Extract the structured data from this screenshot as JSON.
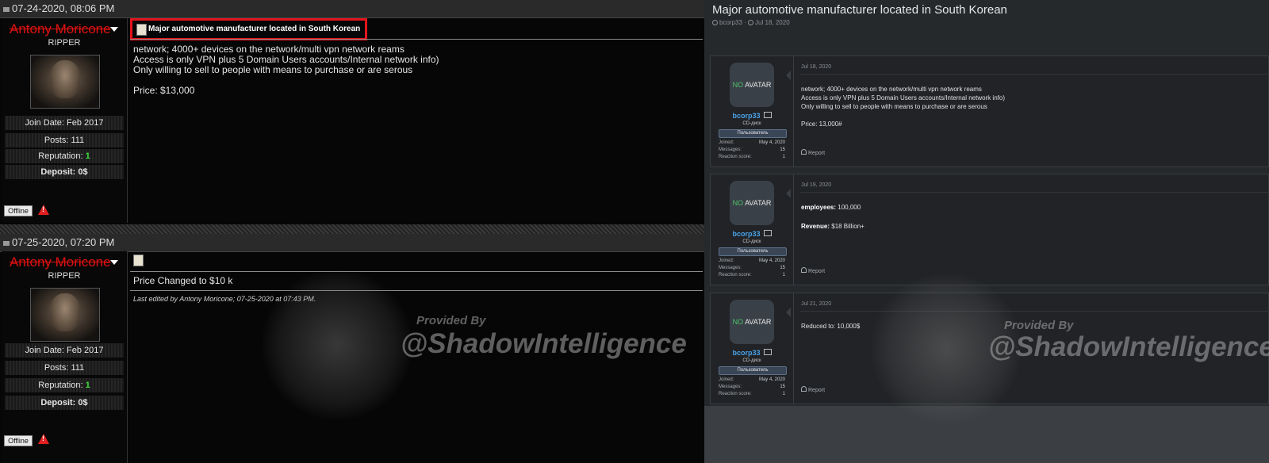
{
  "left_forum": {
    "posts": [
      {
        "header_date": "07-24-2020, 08:06 PM",
        "username": "Antony Moricone",
        "rank": "RIPPER",
        "join_date": "Join Date: Feb 2017",
        "posts": "Posts: 111",
        "reputation_label": "Reputation: ",
        "reputation_value": "1",
        "deposit": "Deposit: 0$",
        "status": "Offline",
        "title": "Major automotive manufacturer located in South Korean",
        "body": "network; 4000+ devices on the network/multi vpn network reams\nAccess is only VPN plus 5 Domain Users accounts/Internal network info)\nOnly willing to sell to people with means to purchase or are serous\n\nPrice: $13,000"
      },
      {
        "header_date": "07-25-2020, 07:20 PM",
        "username": "Antony Moricone",
        "rank": "RIPPER",
        "join_date": "Join Date: Feb 2017",
        "posts": "Posts: 111",
        "reputation_label": "Reputation: ",
        "reputation_value": "1",
        "deposit": "Deposit: 0$",
        "status": "Offline",
        "body": "Price Changed to $10 k",
        "edited": "Last edited by Antony Moricone; 07-25-2020 at 07:43 PM."
      }
    ]
  },
  "right_forum": {
    "thread_title": "Major automotive manufacturer located in South Korean",
    "thread_author": "bcorp33",
    "thread_date": "Jul 18, 2020",
    "posts": [
      {
        "avatar_no": "NO",
        "avatar_text": "AVATAR",
        "username": "bcorp33",
        "subtitle": "CD-диск",
        "badge": "Пользователь",
        "joined_label": "Joined:",
        "joined_value": "May 4, 2020",
        "messages_label": "Messages:",
        "messages_value": "15",
        "reaction_label": "Reaction score:",
        "reaction_value": "1",
        "date": "Jul 18, 2020",
        "body": "network; 4000+ devices on the network/multi vpn network reams\nAccess is only VPN plus 5 Domain Users accounts/Internal network info)\nOnly willing to sell to people with means to purchase or are serous\n\nPrice: 13,000#",
        "report": "Report"
      },
      {
        "avatar_no": "NO",
        "avatar_text": "AVATAR",
        "username": "bcorp33",
        "subtitle": "CD-диск",
        "badge": "Пользователь",
        "joined_label": "Joined:",
        "joined_value": "May 4, 2020",
        "messages_label": "Messages:",
        "messages_value": "15",
        "reaction_label": "Reaction score:",
        "reaction_value": "1",
        "date": "Jul 19, 2020",
        "employees_label": "employees:",
        "employees_value": " 100,000",
        "revenue_label": "Revenue:",
        "revenue_value": " $18 Billion+",
        "report": "Report"
      },
      {
        "avatar_no": "NO",
        "avatar_text": "AVATAR",
        "username": "bcorp33",
        "subtitle": "CD-диск",
        "badge": "Пользователь",
        "joined_label": "Joined:",
        "joined_value": "May 4, 2020",
        "messages_label": "Messages:",
        "messages_value": "15",
        "reaction_label": "Reaction score:",
        "reaction_value": "1",
        "date": "Jul 21, 2020",
        "body": "Reduced to: 10,000$",
        "report": "Report"
      }
    ]
  },
  "watermark": {
    "line1": "Provided By",
    "line2": "@ShadowIntelligence"
  },
  "colors": {
    "username_red": "#e01010",
    "highlight_box": "#e4141c",
    "reputation_green": "#3ddc3d",
    "right_link_blue": "#4aa3e8"
  }
}
